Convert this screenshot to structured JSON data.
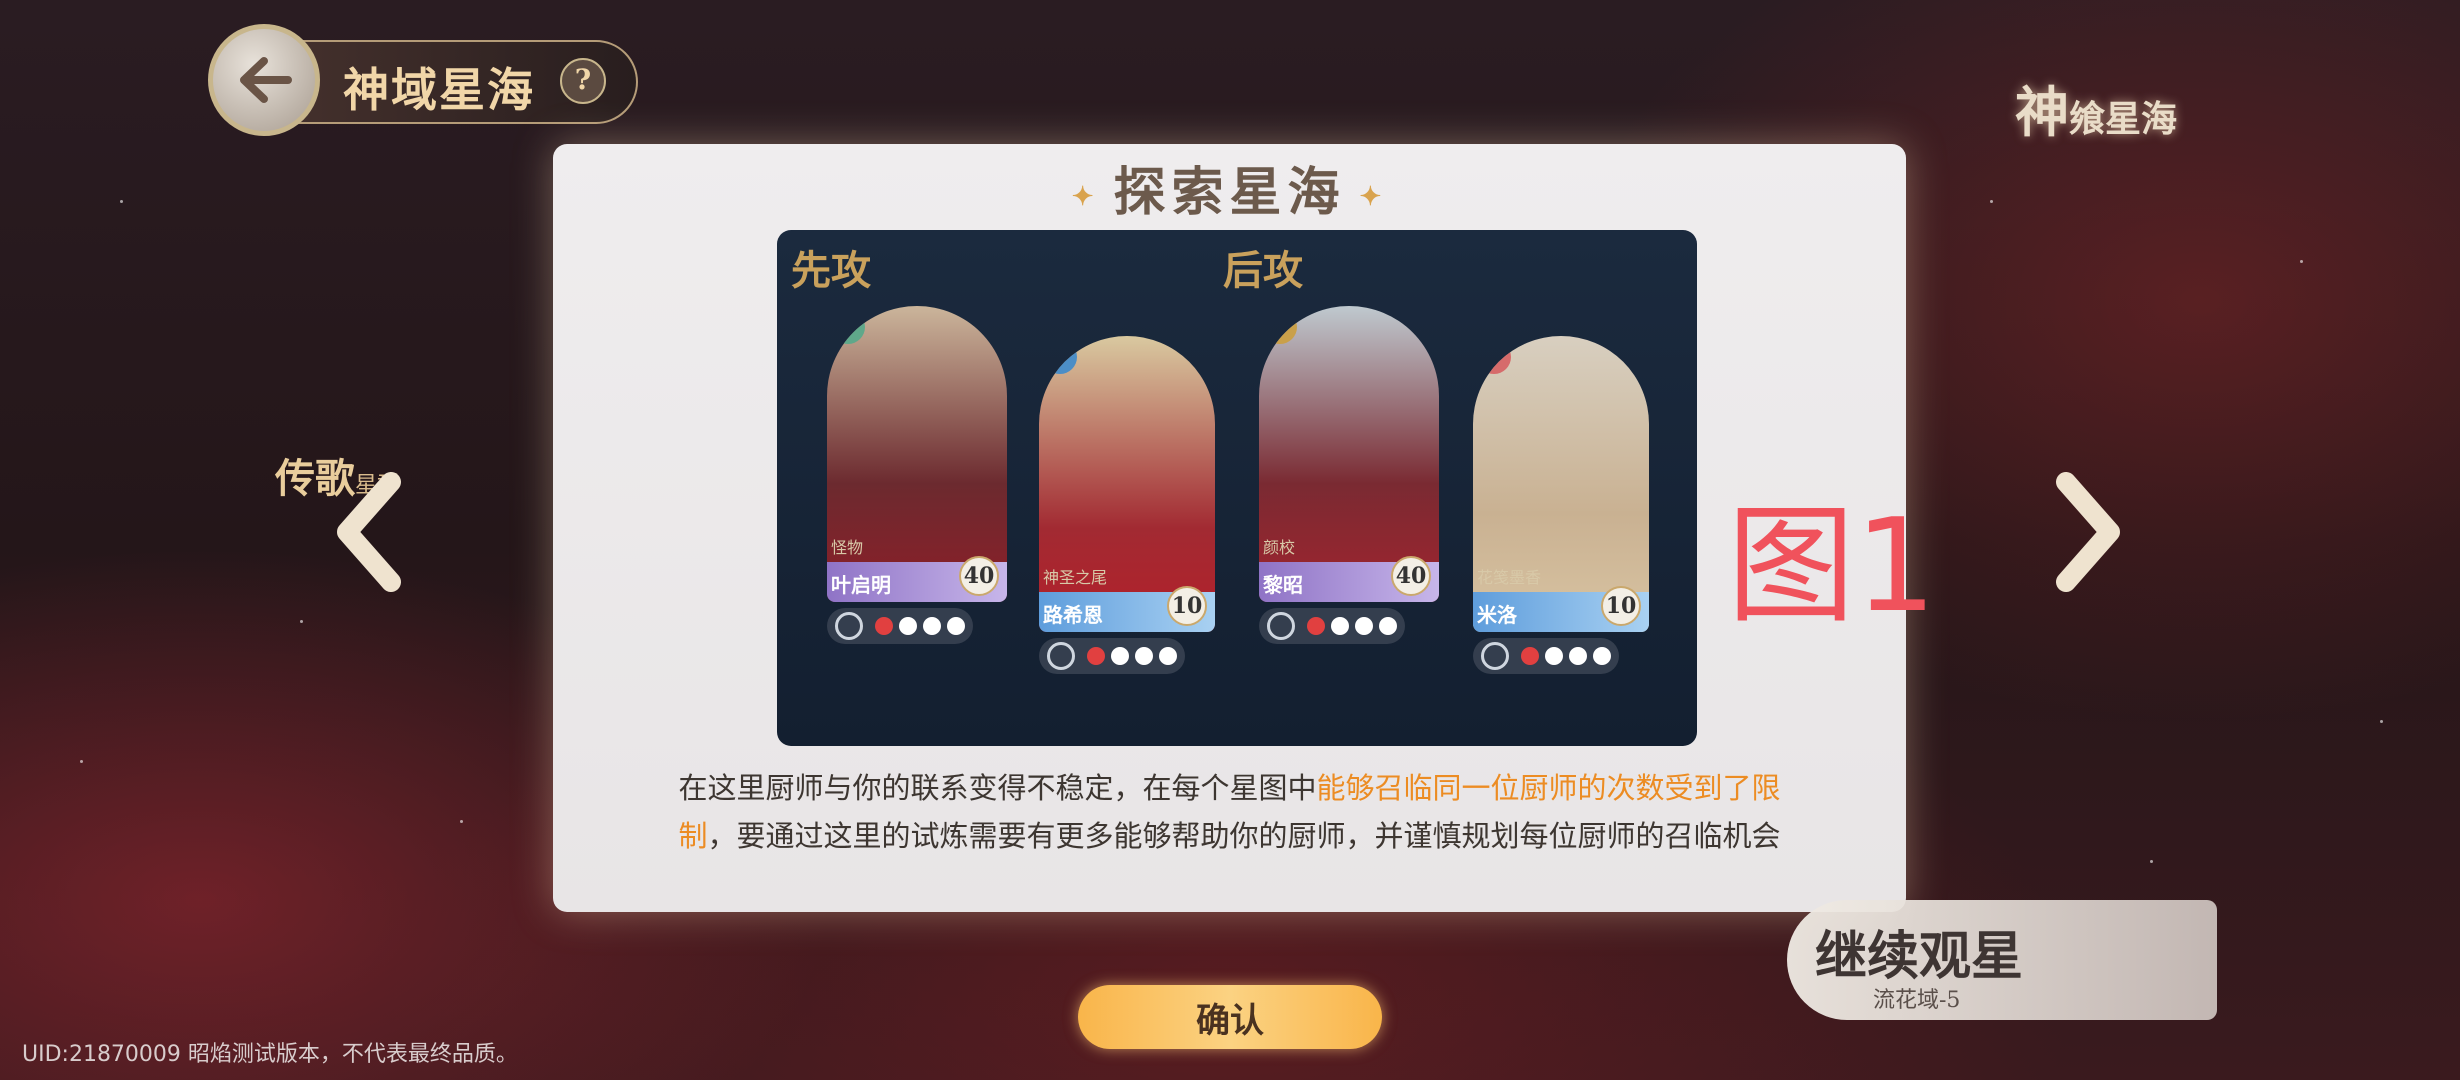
{
  "header": {
    "title": "神域星海",
    "help_label": "?"
  },
  "panel": {
    "title": "探索星海",
    "sections": [
      "先攻",
      "后攻"
    ],
    "cards": [
      {
        "role": "怪物",
        "name": "叶启明",
        "level": "40"
      },
      {
        "role": "神圣之尾",
        "name": "路希恩",
        "level": "10"
      },
      {
        "role": "颜校",
        "name": "黎昭",
        "level": "40"
      },
      {
        "role": "花笺墨香",
        "name": "米洛",
        "level": "10"
      }
    ],
    "figure_label": "图1",
    "description_part1": "在这里厨师与你的联系变得不稳定，在每个星图中",
    "description_highlight": "能够召临同一位厨师的次数受到了限制",
    "description_part2": "，要通过这里的试炼需要有更多能够帮助你的厨师，并谨慎规划每位厨师的召临机会"
  },
  "left_nav": {
    "label": "传歌",
    "sub": "星群"
  },
  "logo": {
    "text": "神",
    "small": "飨星海"
  },
  "continue": {
    "title": "继续观星",
    "subtitle": "流花域-5"
  },
  "confirm_label": "确认",
  "footer": {
    "uid": "UID:21870009  昭焰测试版本，不代表最终品质。"
  },
  "colors": {
    "highlight": "#ec8c23",
    "figure_label": "#f0525c",
    "confirm": "#fbd282"
  }
}
